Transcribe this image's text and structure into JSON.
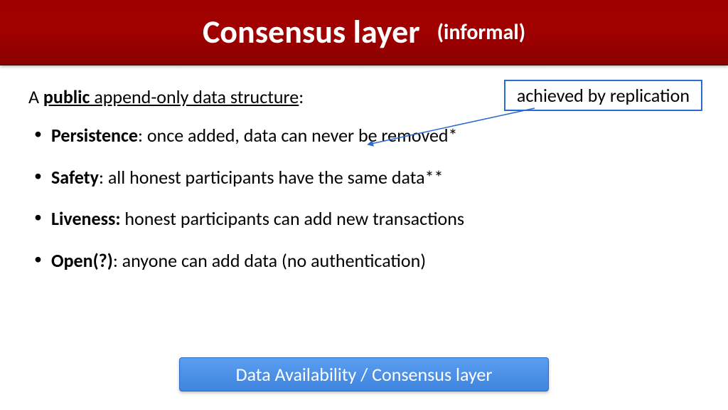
{
  "title": {
    "main": "Consensus layer",
    "sub": "(informal)"
  },
  "intro": {
    "prefix": "A ",
    "public_word": "public",
    "rest": " append-only data structure",
    "suffix": ":"
  },
  "bullets": [
    {
      "term": "Persistence",
      "sep": ": ",
      "desc": "once added, data can never be removed*"
    },
    {
      "term": "Safety",
      "sep": ": ",
      "desc": "all honest participants have the same data**"
    },
    {
      "term": "Liveness:",
      "sep": " ",
      "desc": "honest participants can add new transactions"
    },
    {
      "term": "Open(?)",
      "sep": ": ",
      "desc": "anyone can add data (no authentication)"
    }
  ],
  "callout": "achieved by replication",
  "footer": "Data Availability / Consensus layer",
  "colors": {
    "title_bg": "#a00000",
    "accent": "#2a6bd0",
    "footer_bg": "#4b8fe6"
  }
}
